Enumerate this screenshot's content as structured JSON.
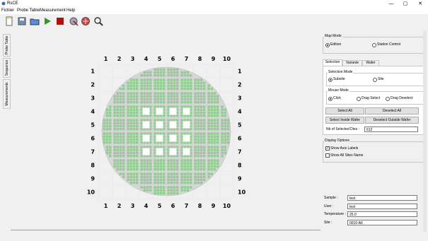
{
  "window": {
    "title": "RsCE",
    "minimize": "—",
    "maximize": "▢",
    "close": "✕"
  },
  "menu": [
    "Fichier",
    "Probe Table",
    "Measurement",
    "Help"
  ],
  "toolbar": [
    "new-file-icon",
    "save-icon",
    "open-folder-icon",
    "play-icon",
    "stop-icon",
    "probe-icon",
    "wafer-icon",
    "tool-icon"
  ],
  "left_tabs": [
    "Probe Table",
    "Sequence",
    "Measurements"
  ],
  "wafer_map": {
    "columns": [
      "1",
      "2",
      "3",
      "4",
      "5",
      "6",
      "7",
      "8",
      "9",
      "10"
    ],
    "rows": [
      "1",
      "2",
      "3",
      "4",
      "5",
      "6",
      "7",
      "8",
      "9",
      "10"
    ]
  },
  "right_panel": {
    "map_mode": {
      "title": "Map Mode",
      "options": [
        {
          "label": "Edition",
          "checked": true
        },
        {
          "label": "Station Control",
          "checked": false
        }
      ]
    },
    "tabs": [
      "Selection",
      "Variante",
      "Wafer"
    ],
    "selection_mode": {
      "title": "Selection Mode",
      "options": [
        {
          "label": "Subsite",
          "checked": true
        },
        {
          "label": "Site",
          "checked": false
        }
      ]
    },
    "mouse_mode": {
      "title": "Mouse Mode",
      "options": [
        {
          "label": "Click",
          "checked": true
        },
        {
          "label": "Drag Select",
          "checked": false
        },
        {
          "label": "Drag Deselect",
          "checked": false
        }
      ]
    },
    "buttons": {
      "select_all": "Select All",
      "deselect_all": "Deselect All",
      "select_inside": "Select Inside Wafer",
      "deselect_outside": "Deselect Outside Wafer"
    },
    "nb_selected": {
      "label": "Nb of Selected Dies :",
      "value": "612"
    },
    "display_options": {
      "title": "Display Options",
      "show_axis_labels": {
        "label": "Show Axis Labels",
        "checked": true
      },
      "show_site_name": {
        "label": "Show All Sites Name",
        "checked": false
      }
    },
    "info": [
      {
        "label": "Sample :",
        "value": "test"
      },
      {
        "label": "User :",
        "value": "test"
      },
      {
        "label": "Temperature :",
        "value": "25.0"
      },
      {
        "label": "Site :",
        "value": "0010-A6"
      }
    ]
  },
  "colors": {
    "selected_die": "#8fcf8f",
    "wafer_fill": "#d6d6d6",
    "die_white": "#ffffff"
  }
}
